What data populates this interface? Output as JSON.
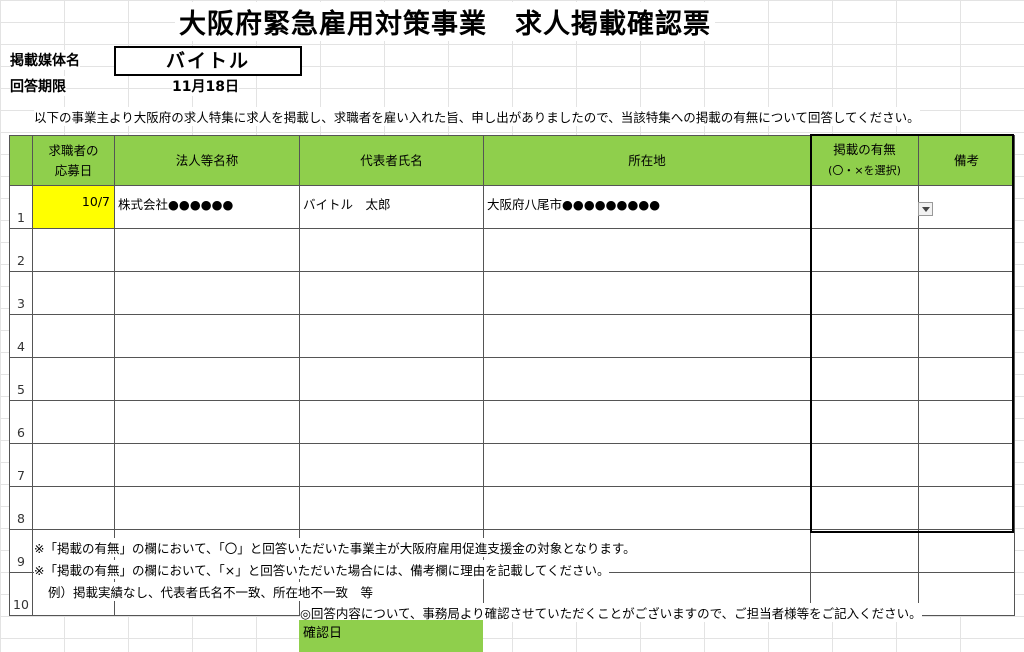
{
  "title": "大阪府緊急雇用対策事業　求人掲載確認票",
  "media": {
    "label": "掲載媒体名",
    "value": "バイトル"
  },
  "deadline": {
    "label": "回答期限",
    "value": "11月18日"
  },
  "intro": "以下の事業主より大阪府の求人特集に求人を掲載し、求職者を雇い入れた旨、申し出がありましたので、当該特集への掲載の有無について回答してください。",
  "table": {
    "headers": {
      "date_line1": "求職者の",
      "date_line2": "応募日",
      "company": "法人等名称",
      "rep": "代表者氏名",
      "address": "所在地",
      "listed_line1": "掲載の有無",
      "listed_line2": "(〇・×を選択)",
      "remarks": "備考"
    },
    "rows": [
      {
        "no": "1",
        "date": "10/7",
        "company": "株式会社●●●●●●",
        "rep": "バイトル　太郎",
        "address": "大阪府八尾市●●●●●●●●●",
        "listed": "",
        "remarks": ""
      },
      {
        "no": "2",
        "date": "",
        "company": "",
        "rep": "",
        "address": "",
        "listed": "",
        "remarks": ""
      },
      {
        "no": "3",
        "date": "",
        "company": "",
        "rep": "",
        "address": "",
        "listed": "",
        "remarks": ""
      },
      {
        "no": "4",
        "date": "",
        "company": "",
        "rep": "",
        "address": "",
        "listed": "",
        "remarks": ""
      },
      {
        "no": "5",
        "date": "",
        "company": "",
        "rep": "",
        "address": "",
        "listed": "",
        "remarks": ""
      },
      {
        "no": "6",
        "date": "",
        "company": "",
        "rep": "",
        "address": "",
        "listed": "",
        "remarks": ""
      },
      {
        "no": "7",
        "date": "",
        "company": "",
        "rep": "",
        "address": "",
        "listed": "",
        "remarks": ""
      },
      {
        "no": "8",
        "date": "",
        "company": "",
        "rep": "",
        "address": "",
        "listed": "",
        "remarks": ""
      },
      {
        "no": "9",
        "date": "",
        "company": "",
        "rep": "",
        "address": "",
        "listed": "",
        "remarks": ""
      },
      {
        "no": "10",
        "date": "",
        "company": "",
        "rep": "",
        "address": "",
        "listed": "",
        "remarks": ""
      }
    ]
  },
  "notes": {
    "note1": "※「掲載の有無」の欄において、「〇」と回答いただいた事業主が大阪府雇用促進支援金の対象となります。",
    "note2": "※「掲載の有無」の欄において、「×」と回答いただいた場合には、備考欄に理由を記載してください。",
    "example": "例）掲載実績なし、代表者氏名不一致、所在地不一致　等",
    "contact": "◎回答内容について、事務局より確認させていただくことがございますので、ご担当者様等をご記入ください。"
  },
  "confirm_label": "確認日",
  "colors": {
    "header_green": "#8fcf4c",
    "highlight_yellow": "#ffff00"
  },
  "icons": {
    "dropdown": "dropdown-arrow-icon"
  }
}
